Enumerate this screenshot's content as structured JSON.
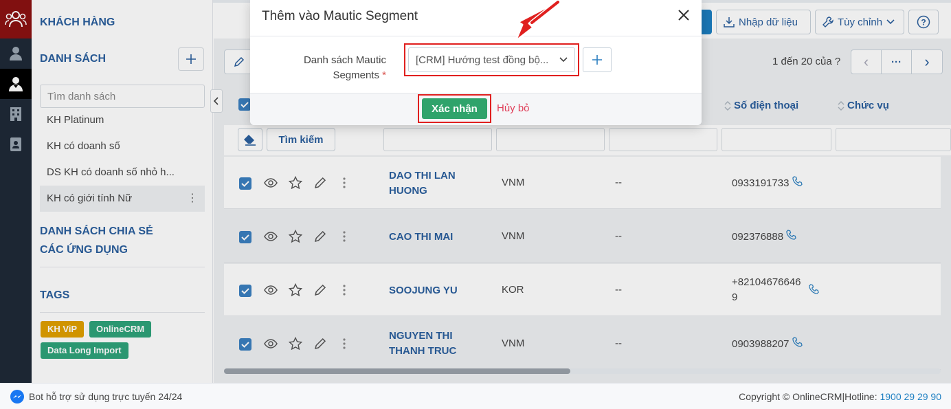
{
  "header": {
    "section_title": "KHÁCH HÀNG",
    "import_label": "Nhập dữ liệu",
    "customize_label": "Tùy chỉnh",
    "help_label": "?"
  },
  "sidebar": {
    "list_header": "DANH SÁCH",
    "add_label": "+",
    "search_placeholder": "Tìm danh sách",
    "items": [
      {
        "label": "KH Platinum"
      },
      {
        "label": "KH có doanh số"
      },
      {
        "label": "DS KH có doanh số nhỏ h..."
      },
      {
        "label": "KH có giới tính Nữ"
      }
    ],
    "item_menu": "⋮",
    "shared_header": "DANH SÁCH CHIA SẺ",
    "apps_header": "CÁC ỨNG DỤNG",
    "tags_header": "TAGS",
    "tags": [
      {
        "label": "KH ViP",
        "color": "#e0a000"
      },
      {
        "label": "OnlineCRM",
        "color": "#2fa37a"
      },
      {
        "label": "Data Long Import",
        "color": "#2fa37a"
      }
    ]
  },
  "toolbar": {
    "paging_text": "1 đến 20 của ?",
    "pager_prev": "‹",
    "pager_more": "···",
    "pager_next": "›"
  },
  "table": {
    "columns": {
      "phone": "Số điện thoại",
      "position": "Chức vụ"
    },
    "search_label": "Tìm kiếm",
    "rows": [
      {
        "name": "DAO THI LAN HUONG",
        "country": "VNM",
        "col3": "--",
        "phone": "0933191733"
      },
      {
        "name": "CAO THI MAI",
        "country": "VNM",
        "col3": "--",
        "phone": "092376888"
      },
      {
        "name": "SOOJUNG YU",
        "country": "KOR",
        "col3": "--",
        "phone": "+82104676646 9"
      },
      {
        "name": "NGUYEN THI THANH TRUC",
        "country": "VNM",
        "col3": "--",
        "phone": "0903988207"
      }
    ]
  },
  "modal": {
    "title": "Thêm vào Mautic Segment",
    "close": "×",
    "field_label": "Danh sách Mautic Segments",
    "required_mark": "*",
    "select_value": "[CRM] Hướng test đồng bộ...",
    "add": "+",
    "confirm": "Xác nhận",
    "cancel": "Hủy bỏ"
  },
  "footer": {
    "bot_text": "Bot hỗ trợ sử dụng trực tuyến 24/24",
    "copyright": "Copyright © OnlineCRM|Hotline: ",
    "hotline": "1900 29 29 90"
  },
  "colors": {
    "accent": "#2b5f9e",
    "confirm": "#2fa36b",
    "highlight": "#e0201f",
    "brand": "#8b1212"
  }
}
